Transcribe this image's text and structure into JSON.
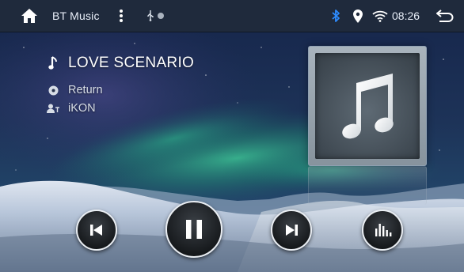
{
  "status_bar": {
    "title": "BT Music",
    "time": "08:26",
    "icons": [
      "home-icon",
      "more-vert-icon",
      "usb-icon",
      "record-dot-icon",
      "bluetooth-icon",
      "location-pin-icon",
      "wifi-icon",
      "back-icon"
    ]
  },
  "now_playing": {
    "song_title": "LOVE SCENARIO",
    "album": "Return",
    "artist": "iKON"
  },
  "controls": [
    "previous-track-icon",
    "pause-icon",
    "next-track-icon",
    "equalizer-icon"
  ],
  "colors": {
    "status_bar_bg": "#1f2a3c",
    "bluetooth_accent": "#2d8cff",
    "text": "#ffffff",
    "aurora_green": "#2fae84"
  }
}
